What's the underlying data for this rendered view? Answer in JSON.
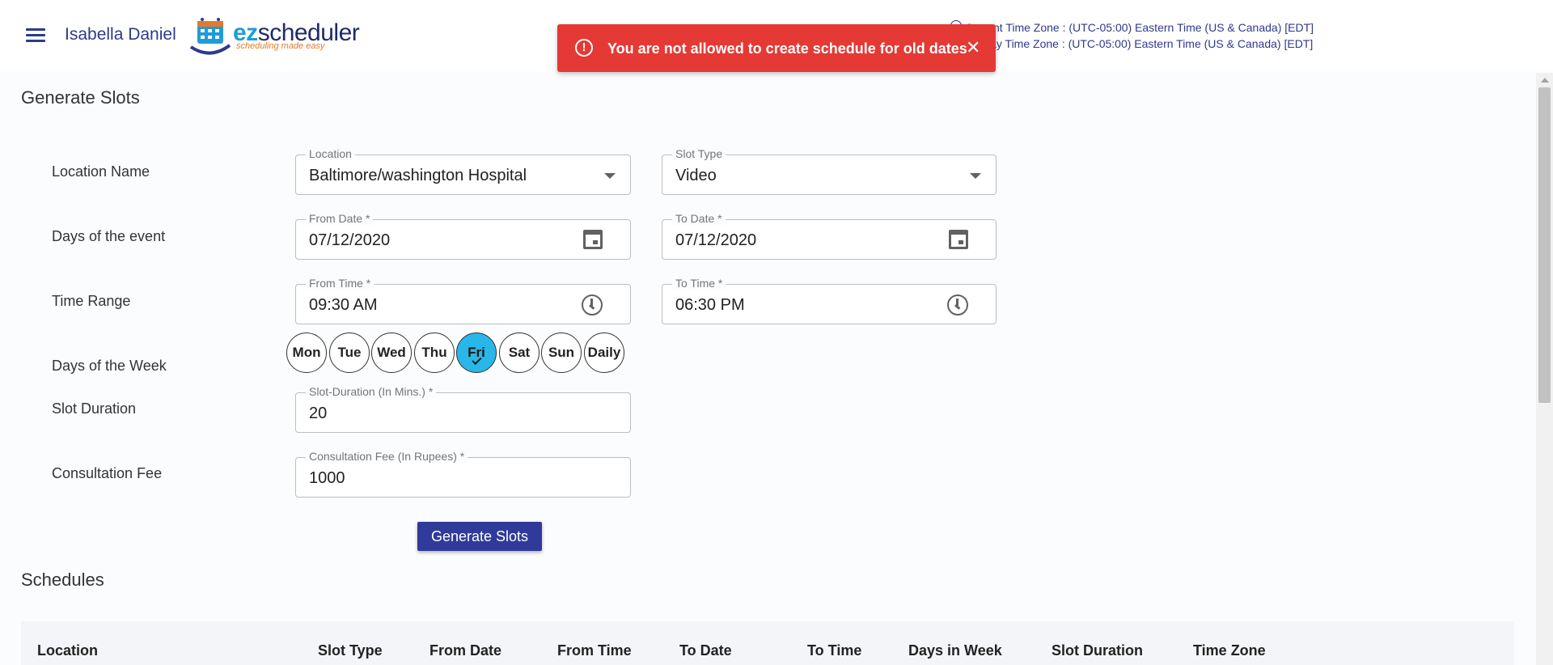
{
  "header": {
    "user_name": "Isabella Daniel",
    "logo": {
      "brand_ez": "ez",
      "brand_rest": "scheduler",
      "tagline": "scheduling made easy"
    },
    "timezone": {
      "current": "Current Time Zone : (UTC-05:00) Eastern Time (US & Canada) [EDT]",
      "display": "Display Time Zone : (UTC-05:00) Eastern Time (US & Canada) [EDT]"
    }
  },
  "toast": {
    "message": "You are not allowed to create schedule for old dates",
    "icon": "error-icon",
    "color": "#e53935"
  },
  "generate": {
    "title": "Generate Slots",
    "labels": {
      "location_name": "Location Name",
      "days_of_event": "Days of the event",
      "time_range": "Time Range",
      "days_of_week": "Days of the Week",
      "slot_duration": "Slot Duration",
      "consultation_fee": "Consultation Fee"
    },
    "location": {
      "label": "Location",
      "value": "Baltimore/washington Hospital"
    },
    "slot_type": {
      "label": "Slot Type",
      "value": "Video"
    },
    "from_date": {
      "label": "From Date *",
      "value": "07/12/2020"
    },
    "to_date": {
      "label": "To Date *",
      "value": "07/12/2020"
    },
    "from_time": {
      "label": "From Time *",
      "value": "09:30 AM"
    },
    "to_time": {
      "label": "To Time *",
      "value": "06:30 PM"
    },
    "days": [
      "Mon",
      "Tue",
      "Wed",
      "Thu",
      "Fri",
      "Sat",
      "Sun",
      "Daily"
    ],
    "selected_day": "Fri",
    "slot_duration": {
      "label": "Slot-Duration (In Mins.) *",
      "value": "20"
    },
    "fee": {
      "label": "Consultation Fee (In Rupees) *",
      "value": "1000"
    },
    "button": "Generate Slots"
  },
  "schedules": {
    "title": "Schedules",
    "columns": [
      "Location",
      "Slot Type",
      "From Date",
      "From Time",
      "To Date",
      "To Time",
      "Days in Week",
      "Slot Duration",
      "Time Zone"
    ]
  },
  "colors": {
    "primary": "#2f3a9a",
    "accent": "#29b6e8",
    "brand_text": "#2d3a8c"
  }
}
